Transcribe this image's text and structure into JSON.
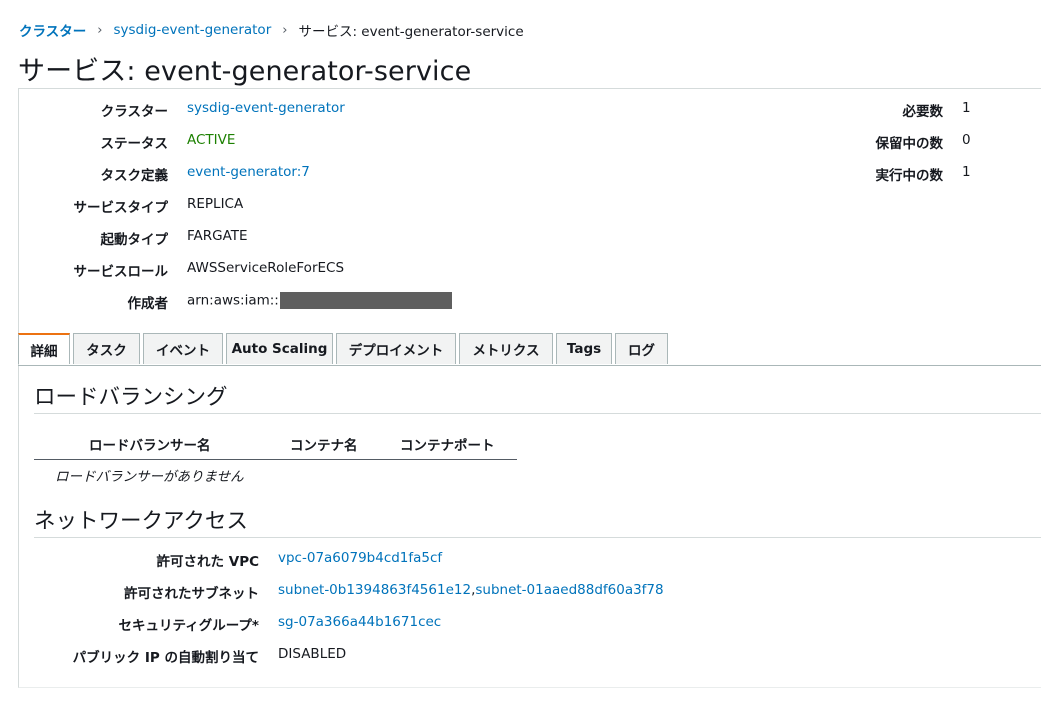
{
  "breadcrumb": {
    "clusters": "クラスター",
    "cluster": "sysdig-event-generator",
    "current": "サービス: event-generator-service"
  },
  "title": "サービス: event-generator-service",
  "summary": {
    "cluster_label": "クラスター",
    "cluster_value": "sysdig-event-generator",
    "status_label": "ステータス",
    "status_value": "ACTIVE",
    "taskdef_label": "タスク定義",
    "taskdef_value": "event-generator:7",
    "servicetype_label": "サービスタイプ",
    "servicetype_value": "REPLICA",
    "launchtype_label": "起動タイプ",
    "launchtype_value": "FARGATE",
    "role_label": "サービスロール",
    "role_value": "AWSServiceRoleForECS",
    "creator_label": "作成者",
    "creator_value": "arn:aws:iam::",
    "desired_label": "必要数",
    "desired_value": "1",
    "pending_label": "保留中の数",
    "pending_value": "0",
    "running_label": "実行中の数",
    "running_value": "1"
  },
  "tabs": [
    "詳細",
    "タスク",
    "イベント",
    "Auto Scaling",
    "デプロイメント",
    "メトリクス",
    "Tags",
    "ログ"
  ],
  "load_balancing": {
    "heading": "ロードバランシング",
    "columns": [
      "ロードバランサー名",
      "コンテナ名",
      "コンテナポート"
    ],
    "empty": "ロードバランサーがありません"
  },
  "network": {
    "heading": "ネットワークアクセス",
    "vpc_label": "許可された VPC",
    "vpc_value": "vpc-07a6079b4cd1fa5cf",
    "subnets_label": "許可されたサブネット",
    "subnet1": "subnet-0b1394863f4561e12",
    "subnet_sep": ",",
    "subnet2": "subnet-01aaed88df60a3f78",
    "sg_label": "セキュリティグループ*",
    "sg_value": "sg-07a366a44b1671cec",
    "publicip_label": "パブリック IP の自動割り当て",
    "publicip_value": "DISABLED"
  },
  "colors": {
    "link": "#0073bb",
    "active_status": "#1d8102",
    "tab_accent": "#ec7211"
  }
}
